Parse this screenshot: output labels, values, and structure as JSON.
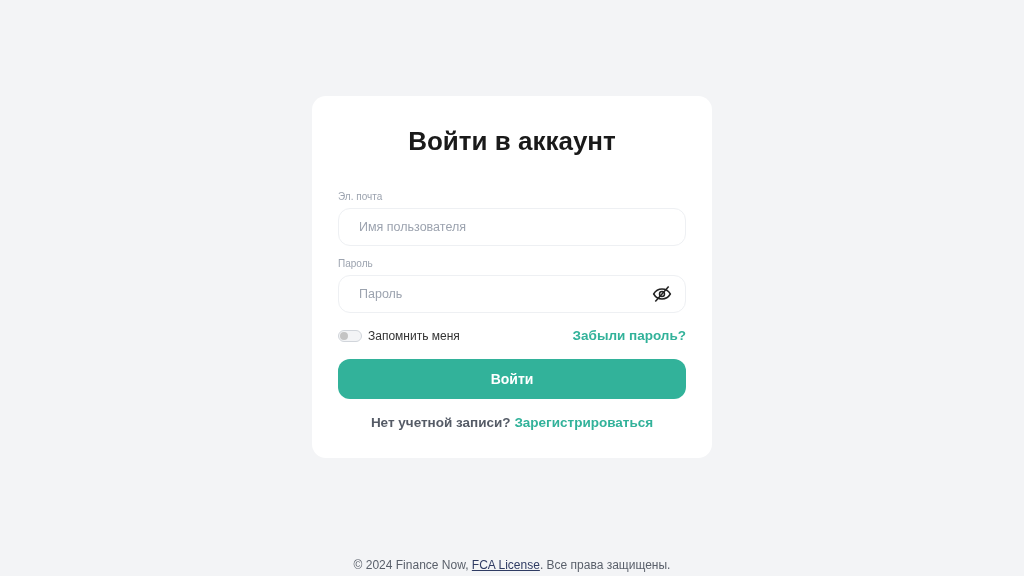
{
  "card": {
    "title": "Войти в аккаунт",
    "fields": [
      {
        "label": "Эл. почта",
        "placeholder": "Имя пользователя",
        "kind": "text"
      },
      {
        "label": "Пароль",
        "placeholder": "Пароль",
        "kind": "password"
      }
    ],
    "remember": {
      "label": "Запомнить меня",
      "on": false
    },
    "forgot_link": "Забыли пароль?",
    "submit_button": "Войти",
    "signup": {
      "text": "Нет учетной записи?",
      "link": "Зарегистрироваться"
    }
  },
  "footer": {
    "before": "© 2024 Finance Now, ",
    "link": "FCA License",
    "after": ". Все права защищены."
  }
}
